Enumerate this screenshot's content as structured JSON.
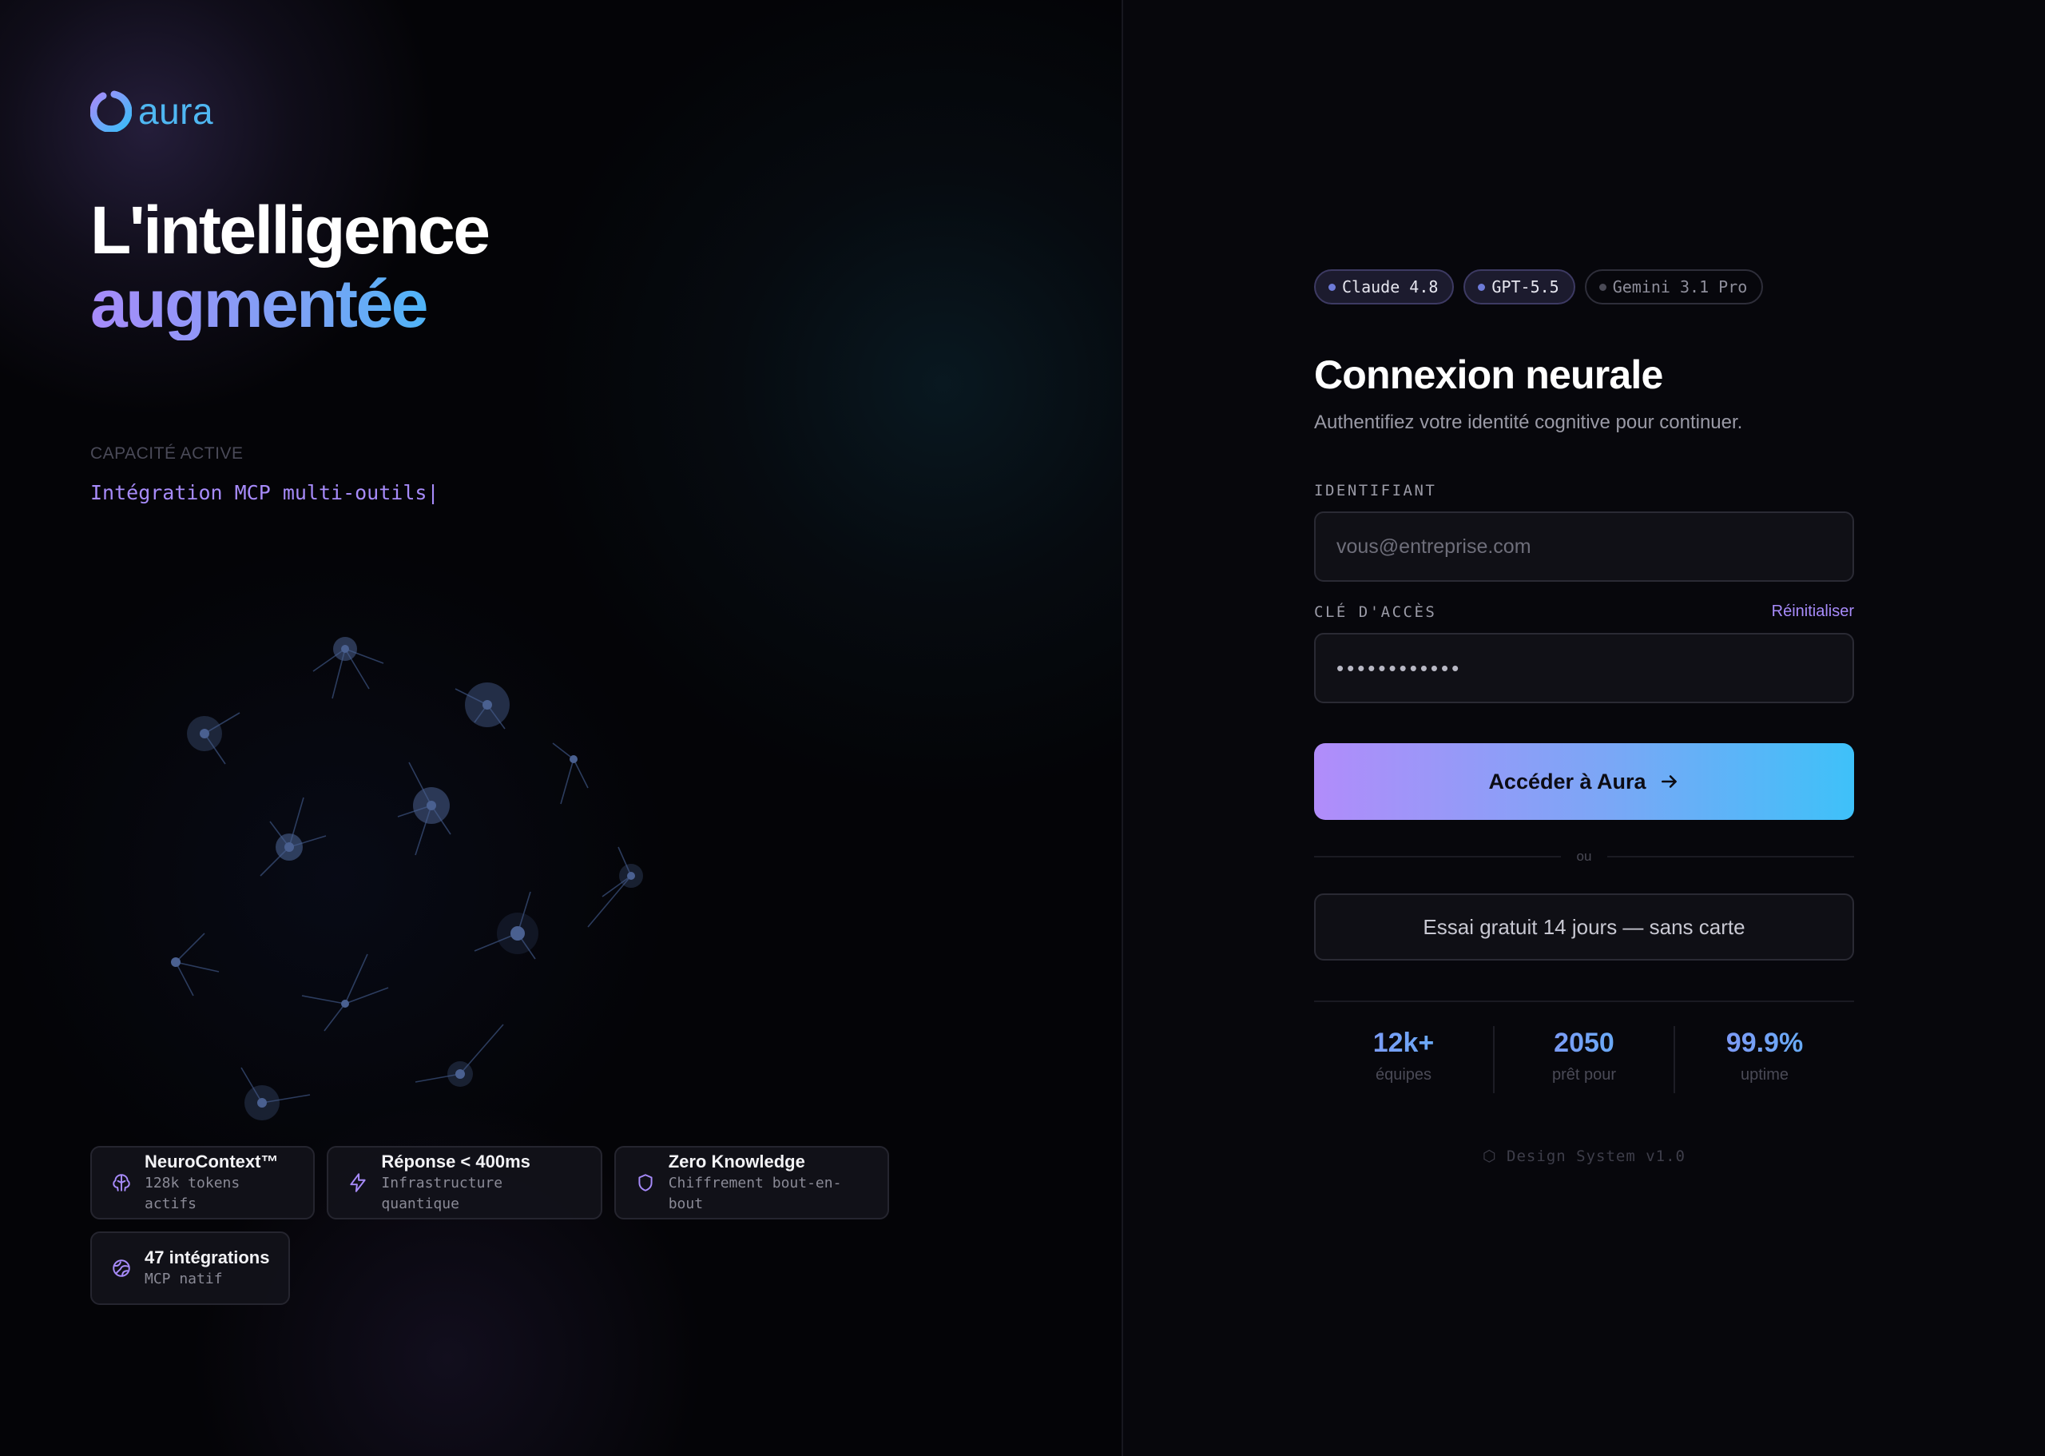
{
  "brand": {
    "name": "aura",
    "color": "#4fb7f2",
    "accent": "#a78bfa"
  },
  "hero": {
    "headline_line1": "L'intelligence",
    "headline_line2": "augmentée",
    "capacity_label": "CAPACITÉ ACTIVE",
    "capacity_value": "Intégration MCP multi-outils",
    "caret": "|"
  },
  "features": [
    {
      "icon": "brain-icon",
      "title": "NeuroContext™",
      "subtitle": "128k tokens actifs"
    },
    {
      "icon": "lightning-icon",
      "title": "Réponse < 400ms",
      "subtitle": "Infrastructure quantique"
    },
    {
      "icon": "shield-icon",
      "title": "Zero Knowledge",
      "subtitle": "Chiffrement bout-en-bout"
    },
    {
      "icon": "globe-icon",
      "title": "47 intégrations",
      "subtitle": "MCP natif"
    }
  ],
  "auth": {
    "models": [
      {
        "label": "Claude 4.8",
        "state": "active"
      },
      {
        "label": "GPT-5.5",
        "state": "active"
      },
      {
        "label": "Gemini 3.1 Pro",
        "state": "idle"
      }
    ],
    "title": "Connexion neurale",
    "subtitle": "Authentifiez votre identité cognitive pour continuer.",
    "identifier": {
      "label": "IDENTIFIANT",
      "placeholder": "vous@entreprise.com",
      "value": ""
    },
    "password": {
      "label": "CLÉ D'ACCÈS",
      "reset_label": "Réinitialiser",
      "value": "••••••••••••"
    },
    "submit_label": "Accéder à Aura",
    "divider_label": "ou",
    "trial_label": "Essai gratuit 14 jours — sans carte",
    "stats": [
      {
        "value": "12k+",
        "label": "équipes"
      },
      {
        "value": "2050",
        "label": "prêt pour"
      },
      {
        "value": "99.9%",
        "label": "uptime"
      }
    ],
    "version": "⬡ Design System v1.0"
  }
}
